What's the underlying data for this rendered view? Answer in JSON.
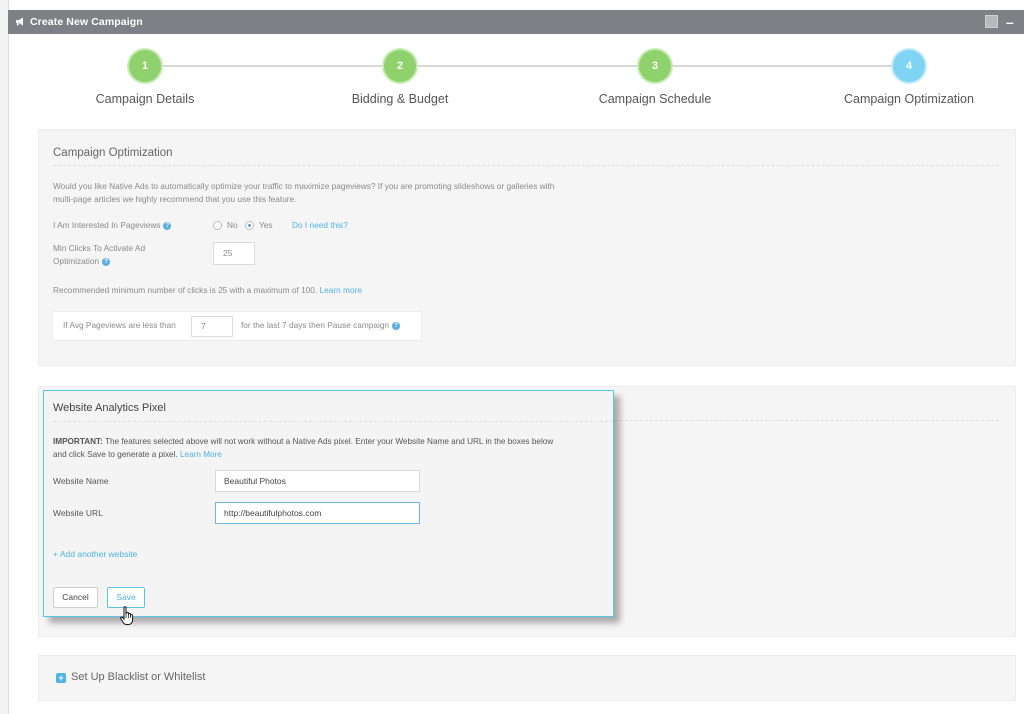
{
  "window": {
    "title": "Create New Campaign",
    "minimize_glyph": "–"
  },
  "steps": [
    {
      "number": "1",
      "label": "Campaign Details",
      "state": "done"
    },
    {
      "number": "2",
      "label": "Bidding & Budget",
      "state": "done"
    },
    {
      "number": "3",
      "label": "Campaign Schedule",
      "state": "done"
    },
    {
      "number": "4",
      "label": "Campaign Optimization",
      "state": "active"
    }
  ],
  "optimization": {
    "title": "Campaign Optimization",
    "description_line1": "Would you like Native Ads to automatically optimize your traffic to maximize pageviews? If you are promoting slideshows or galleries with",
    "description_line2": "multi-page articles we highly recommend that you use this feature.",
    "pageviews_label": "I Am Interested In Pageviews",
    "option_no": "No",
    "option_yes": "Yes",
    "selected": "Yes",
    "need_link": "Do I need this?",
    "min_clicks_label_line1": "Min Clicks To Activate Ad",
    "min_clicks_label_line2": "Optimization",
    "min_clicks_value": "25",
    "recommend_text": "Recommended minimum number of clicks is 25 with a maximum of 100.",
    "learn_more": "Learn more",
    "avg_prefix": "If Avg Pageviews are less than",
    "avg_value": "7",
    "avg_suffix": "for the last 7 days then Pause campaign"
  },
  "pixel_modal": {
    "title": "Website Analytics Pixel",
    "important_label": "IMPORTANT:",
    "important_text_line1": " The features selected above will not work without a Native Ads pixel. Enter your Website Name and URL in the boxes below",
    "important_text_line2": "and click Save to generate a pixel.",
    "learn_more": "Learn More",
    "website_name_label": "Website Name",
    "website_name_value": "Beautiful Photos",
    "website_url_label": "Website URL",
    "website_url_value": "http://beautifulphotos.com",
    "add_website": "+ Add another website",
    "cancel_label": "Cancel",
    "save_label": "Save"
  },
  "blacklist": {
    "label": "Set Up Blacklist or Whitelist"
  },
  "colors": {
    "step_done": "#8fd16d",
    "step_active": "#7fd4f3",
    "accent": "#4fb3e5",
    "titlebar": "#7f8085"
  }
}
